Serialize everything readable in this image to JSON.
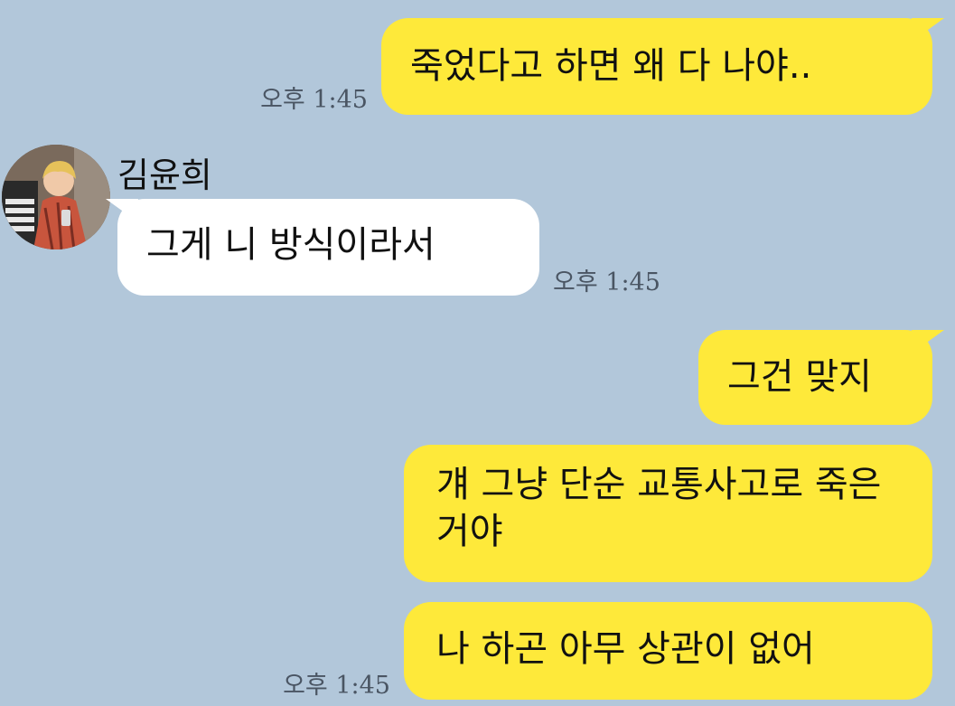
{
  "conversation": {
    "contact_name": "김윤희",
    "messages": [
      {
        "sender": "me",
        "text": "죽었다고 하면 왜 다 나야..",
        "time": "오후 1:45"
      },
      {
        "sender": "김윤희",
        "text": "그게 니 방식이라서",
        "time": "오후 1:45"
      },
      {
        "sender": "me",
        "text": "그건 맞지",
        "time": ""
      },
      {
        "sender": "me",
        "text": "걔 그냥 단순 교통사고로 죽은거야",
        "time": ""
      },
      {
        "sender": "me",
        "text": "나 하곤 아무 상관이 없어",
        "time": "오후 1:45"
      }
    ]
  },
  "colors": {
    "background": "#b2c7da",
    "my_bubble": "#fee93a",
    "other_bubble": "#ffffff",
    "time_text": "#4a5563"
  },
  "icons": {
    "avatar": "profile-photo"
  }
}
